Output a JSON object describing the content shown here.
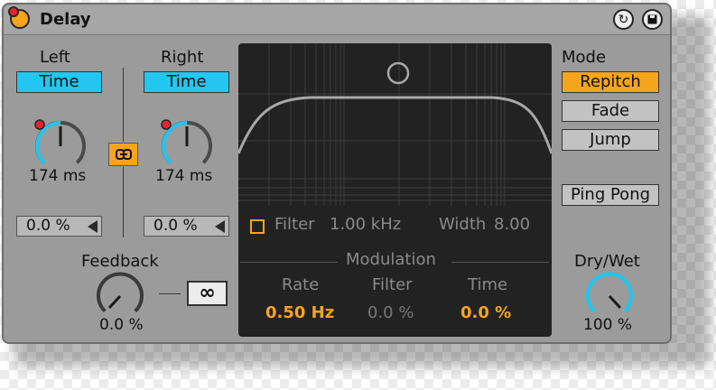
{
  "device": {
    "title": "Delay",
    "icons": {
      "power": "power-icon",
      "hot_swap": "hot-swap-icon",
      "save": "save-preset-icon"
    }
  },
  "left": {
    "label": "Left",
    "mode_button": "Time",
    "time_value": "174 ms",
    "offset_value": "0.0 %"
  },
  "right": {
    "label": "Right",
    "mode_button": "Time",
    "time_value": "174 ms",
    "offset_value": "0.0 %"
  },
  "link_icon": "link-icon",
  "feedback": {
    "label": "Feedback",
    "value": "0.0 %",
    "freeze_label": "∞"
  },
  "filter_display": {
    "filter_label": "Filter",
    "filter_value": "1.00 kHz",
    "width_label": "Width",
    "width_value": "8.00"
  },
  "modulation": {
    "header": "Modulation",
    "rate_label": "Rate",
    "rate_value": "0.50 Hz",
    "filter_label": "Filter",
    "filter_value": "0.0 %",
    "time_label": "Time",
    "time_value": "0.0 %"
  },
  "mode": {
    "label": "Mode",
    "options": [
      "Repitch",
      "Fade",
      "Jump"
    ],
    "selected": "Repitch",
    "ping_pong_label": "Ping Pong"
  },
  "dry_wet": {
    "label": "Dry/Wet",
    "value": "100 %"
  },
  "colors": {
    "accent_orange": "#f5a51a",
    "accent_cyan": "#22c6f0",
    "panel_grey": "#9b9b9b",
    "display_bg": "#222222",
    "record_red": "#e8242b"
  }
}
